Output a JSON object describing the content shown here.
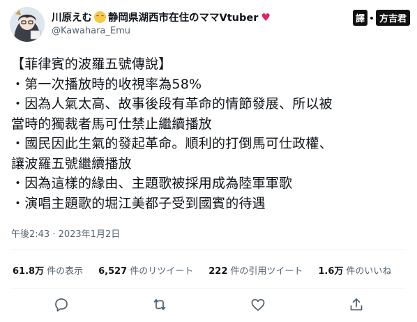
{
  "header": {
    "display_name_part1": "川原えむ",
    "display_name_part2": "静岡県湖西市在住のママVtuber",
    "handle": "@Kawahara_Emu",
    "heart_glyph": "♥"
  },
  "translator_badge": {
    "prefix": "譯",
    "name": "方吉君"
  },
  "body": {
    "lines": [
      "【菲律賓的波羅五號傳說】",
      "・第一次播放時的收視率為58%",
      "・因為人氣太高、故事後段有革命的情節發展、所以被",
      "當時的獨裁者馬可仕禁止繼續播放",
      "・國民因此生氣的發起革命。順利的打倒馬可仕政權、",
      "讓波羅五號繼續播放",
      "・因為這樣的緣由、主題歌被採用成為陸軍軍歌",
      "・演唱主題歌的堀江美都子受到國賓的待遇"
    ]
  },
  "timestamp": "午後2:43 · 2023年1月2日",
  "stats": [
    {
      "num": "61.8万",
      "label": "件の表示"
    },
    {
      "num": "6,527",
      "label": "件のリツイート"
    },
    {
      "num": "222",
      "label": "件の引用ツイート"
    },
    {
      "num": "1.6万",
      "label": "件のいいね"
    }
  ],
  "colors": {
    "text": "#0f1419",
    "secondary": "#536471",
    "heart": "#e0245e",
    "divider": "#eff3f4"
  },
  "icons": {
    "reply": "reply-icon",
    "retweet": "retweet-icon",
    "like": "like-icon",
    "share": "share-icon"
  }
}
